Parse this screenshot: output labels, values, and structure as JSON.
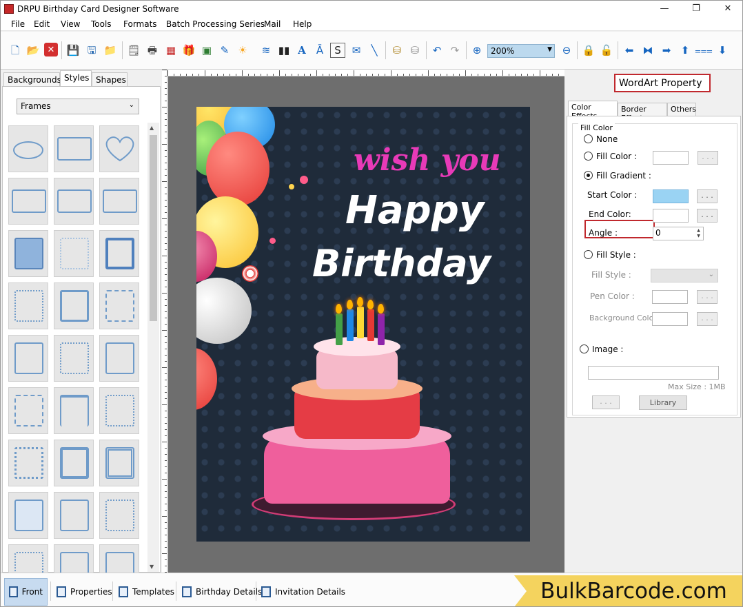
{
  "window": {
    "title": "DRPU Birthday Card Designer Software",
    "minimize": "—",
    "maximize": "❐",
    "close": "✕"
  },
  "menu": [
    "File",
    "Edit",
    "View",
    "Tools",
    "Formats",
    "Batch Processing Series",
    "Mail",
    "Help"
  ],
  "toolbar": {
    "zoom": "200%",
    "icons": [
      "new-icon",
      "open-icon",
      "close-file-icon",
      "save-icon",
      "save-as-icon",
      "export-icon",
      "properties-icon",
      "print-icon",
      "print-multiple-icon",
      "gift-icon",
      "image-icon",
      "image-edit-icon",
      "pen-icon",
      "picture-icon",
      "barcode-icon",
      "text-icon",
      "text-frame-icon",
      "signature-icon",
      "mail-icon",
      "line-icon",
      "database-icon",
      "database-edit-icon",
      "undo-icon",
      "redo-icon",
      "zoom-in-icon",
      "zoom-out-icon",
      "lock-icon",
      "unlock-icon",
      "arrow-left-icon",
      "flip-icon",
      "arrow-right-icon",
      "arrow-up-icon",
      "align-icon",
      "arrow-down-icon"
    ]
  },
  "left_panel": {
    "tabs": [
      "Backgrounds",
      "Styles",
      "Shapes"
    ],
    "active_tab": "Styles",
    "category": "Frames"
  },
  "card": {
    "line1": "wish you",
    "line2": "Happy",
    "line3": "Birthday"
  },
  "right_panel": {
    "title": "WordArt Property",
    "tabs": [
      "Color Effects",
      "Border Effect",
      "Others"
    ],
    "active_tab": "Color Effects",
    "group": "Fill Color",
    "opt_none": "None",
    "opt_fill_color": "Fill Color :",
    "opt_fill_gradient": "Fill Gradient :",
    "start_color": "Start Color :",
    "end_color": "End Color:",
    "angle": "Angle :",
    "angle_value": "0",
    "opt_fill_style": "Fill Style :",
    "fill_style": "Fill Style :",
    "pen_color": "Pen Color :",
    "background_color": "Background Color :",
    "opt_image": "Image :",
    "max_size": "Max Size : 1MB",
    "browse": ". . .",
    "library": "Library",
    "selected_option": "Fill Gradient",
    "start_color_hex": "#9ad3f3",
    "end_color_hex": "#ffffff"
  },
  "bottom_tabs": [
    "Front",
    "Properties",
    "Templates",
    "Birthday Details",
    "Invitation Details"
  ],
  "active_bottom_tab": "Front",
  "brand": "BulkBarcode.com"
}
